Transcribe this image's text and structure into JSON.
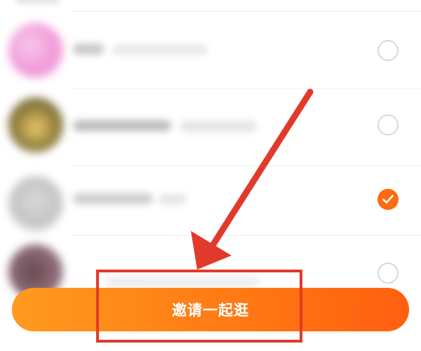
{
  "contact_list": {
    "rows": [
      {
        "selected": false
      },
      {
        "selected": false
      },
      {
        "selected": true
      },
      {
        "selected": false
      }
    ]
  },
  "invite_button": {
    "label": "邀请一起逛"
  },
  "colors": {
    "accent": "#ff6a13",
    "button_gradient_start": "#ff9a1f",
    "button_gradient_end": "#ff5f0f",
    "annotation_red": "#e23a2a",
    "checkbox_border": "#d8d8d8"
  },
  "icons": {
    "checked": "checkmark-icon",
    "annotation_arrow": "arrow-icon"
  }
}
